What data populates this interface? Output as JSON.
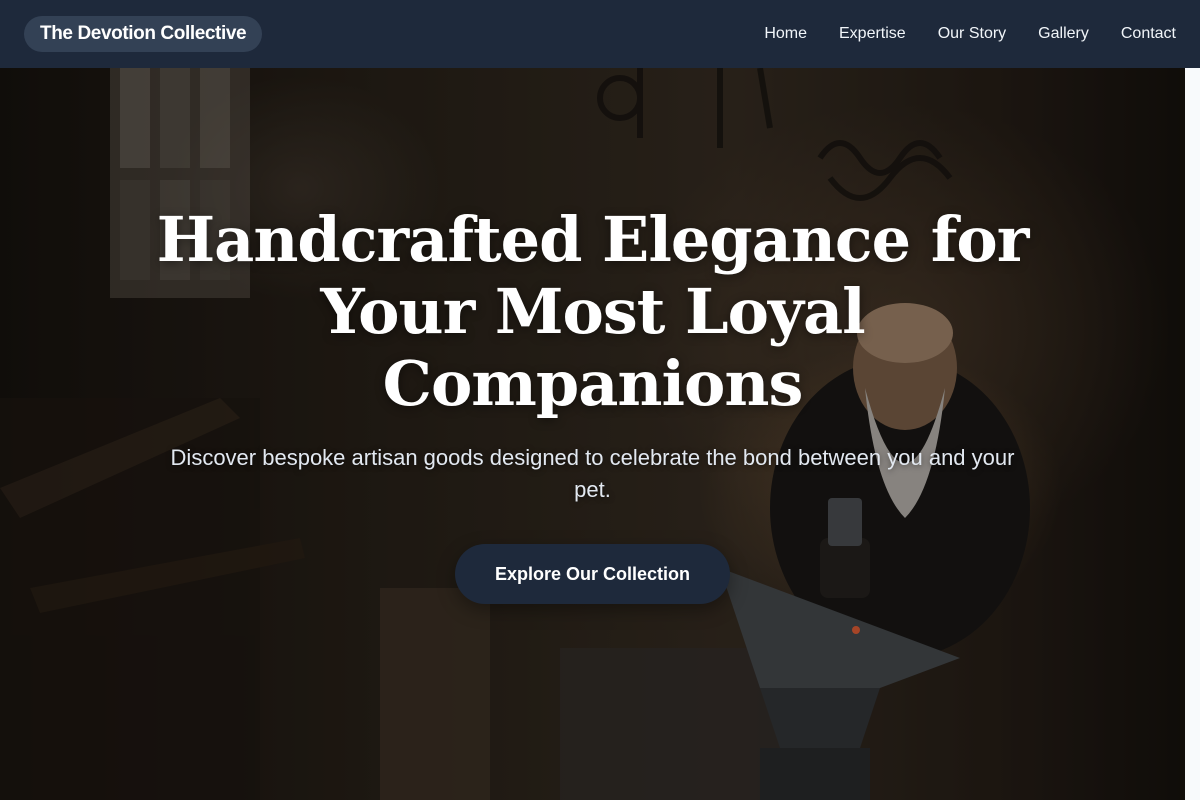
{
  "header": {
    "brand": "The Devotion Collective",
    "nav": [
      {
        "label": "Home"
      },
      {
        "label": "Expertise"
      },
      {
        "label": "Our Story"
      },
      {
        "label": "Gallery"
      },
      {
        "label": "Contact"
      }
    ]
  },
  "hero": {
    "title": "Handcrafted Elegance for Your Most Loyal Companions",
    "subtitle": "Discover bespoke artisan goods designed to celebrate the bond between you and your pet.",
    "cta_label": "Explore Our Collection",
    "image_description_icon": "blacksmith-workshop-photo"
  },
  "colors": {
    "nav_background": "#1e293b",
    "brand_pill": "#334155",
    "cta_background": "#1e293b",
    "text": "#ffffff"
  }
}
